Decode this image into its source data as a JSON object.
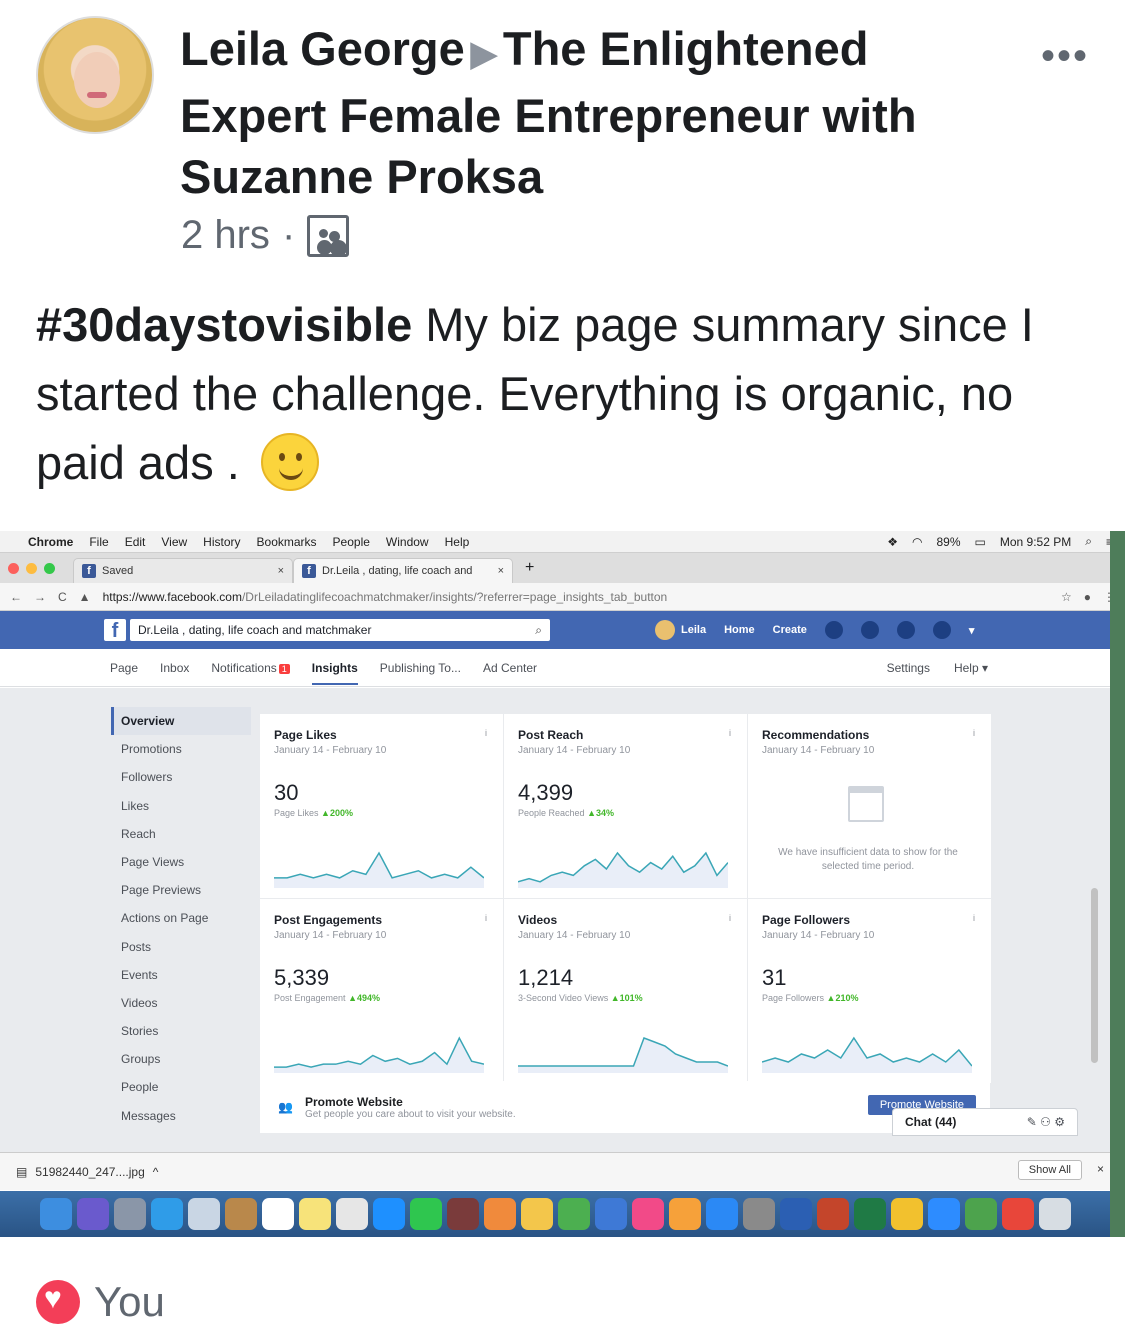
{
  "post": {
    "author": "Leila George",
    "group": "The Enlightened Expert Female Entrepreneur with Suzanne Proksa",
    "time": "2 hrs",
    "dot": "·",
    "hashtag": "#30daystovisible",
    "text": " My biz page summary since I started the challenge. Everything is organic, no paid ads . ",
    "more": "•••",
    "reactions": "You"
  },
  "mac": {
    "apple": "",
    "app": "Chrome",
    "menus": [
      "File",
      "Edit",
      "View",
      "History",
      "Bookmarks",
      "People",
      "Window",
      "Help"
    ],
    "battery": "89%",
    "clock": "Mon 9:52 PM"
  },
  "browser": {
    "tabs": [
      {
        "title": "Saved",
        "close": "×"
      },
      {
        "title": "Dr.Leila , dating, life coach and",
        "close": "×"
      }
    ],
    "new_tab": "+",
    "url_domain": "https://www.facebook.com",
    "url_path": "/DrLeiladatinglifecoachmatchmaker/insights/?referrer=page_insights_tab_button"
  },
  "fb": {
    "search_value": "Dr.Leila , dating,  life coach and matchmaker",
    "user": "Leila",
    "home": "Home",
    "create": "Create",
    "page_tabs": [
      "Page",
      "Inbox",
      "Notifications",
      "Insights",
      "Publishing To...",
      "Ad Center"
    ],
    "notif_count": "1",
    "settings": "Settings",
    "help": "Help ▾"
  },
  "sidebar": [
    "Overview",
    "Promotions",
    "Followers",
    "Likes",
    "Reach",
    "Page Views",
    "Page Previews",
    "Actions on Page",
    "Posts",
    "Events",
    "Videos",
    "Stories",
    "Groups",
    "People",
    "Messages"
  ],
  "cards": [
    {
      "title": "Page Likes",
      "date": "January 14 - February 10",
      "value": "30",
      "label": "Page Likes",
      "change": "▲200%"
    },
    {
      "title": "Post Reach",
      "date": "January 14 - February 10",
      "value": "4,399",
      "label": "People Reached",
      "change": "▲34%"
    },
    {
      "title": "Recommendations",
      "date": "January 14 - February 10",
      "value": "",
      "label": "We have insufficient data to show for the selected time period.",
      "change": ""
    },
    {
      "title": "Post Engagements",
      "date": "January 14 - February 10",
      "value": "5,339",
      "label": "Post Engagement",
      "change": "▲494%"
    },
    {
      "title": "Videos",
      "date": "January 14 - February 10",
      "value": "1,214",
      "label": "3-Second Video Views",
      "change": "▲101%"
    },
    {
      "title": "Page Followers",
      "date": "January 14 - February 10",
      "value": "31",
      "label": "Page Followers",
      "change": "▲210%"
    }
  ],
  "promote": {
    "title": "Promote Website",
    "sub": "Get people you care about to visit your website.",
    "button": "Promote Website"
  },
  "chat": {
    "label": "Chat (44)"
  },
  "download": {
    "file": "51982440_247....jpg",
    "show_all": "Show All",
    "close": "×"
  },
  "sparklines": {
    "page_likes": [
      2,
      2,
      3,
      2,
      3,
      2,
      4,
      3,
      9,
      2,
      3,
      4,
      2,
      3,
      2,
      5,
      2
    ],
    "post_reach": [
      1,
      2,
      1,
      3,
      4,
      3,
      6,
      8,
      5,
      10,
      6,
      4,
      7,
      5,
      9,
      4,
      6,
      10,
      3,
      7
    ],
    "post_engagements": [
      1,
      1,
      2,
      1,
      2,
      2,
      3,
      2,
      5,
      3,
      4,
      2,
      3,
      6,
      2,
      11,
      3,
      2
    ],
    "videos": [
      1,
      1,
      1,
      1,
      1,
      1,
      1,
      1,
      1,
      1,
      1,
      1,
      8,
      7,
      6,
      4,
      3,
      2,
      2,
      2,
      1
    ],
    "page_followers": [
      2,
      3,
      2,
      4,
      3,
      5,
      3,
      8,
      3,
      4,
      2,
      3,
      2,
      4,
      2,
      5,
      1
    ]
  },
  "colors": {
    "fb_blue": "#4267b2",
    "spark": "#3aa6b6",
    "up": "#42b72a"
  }
}
